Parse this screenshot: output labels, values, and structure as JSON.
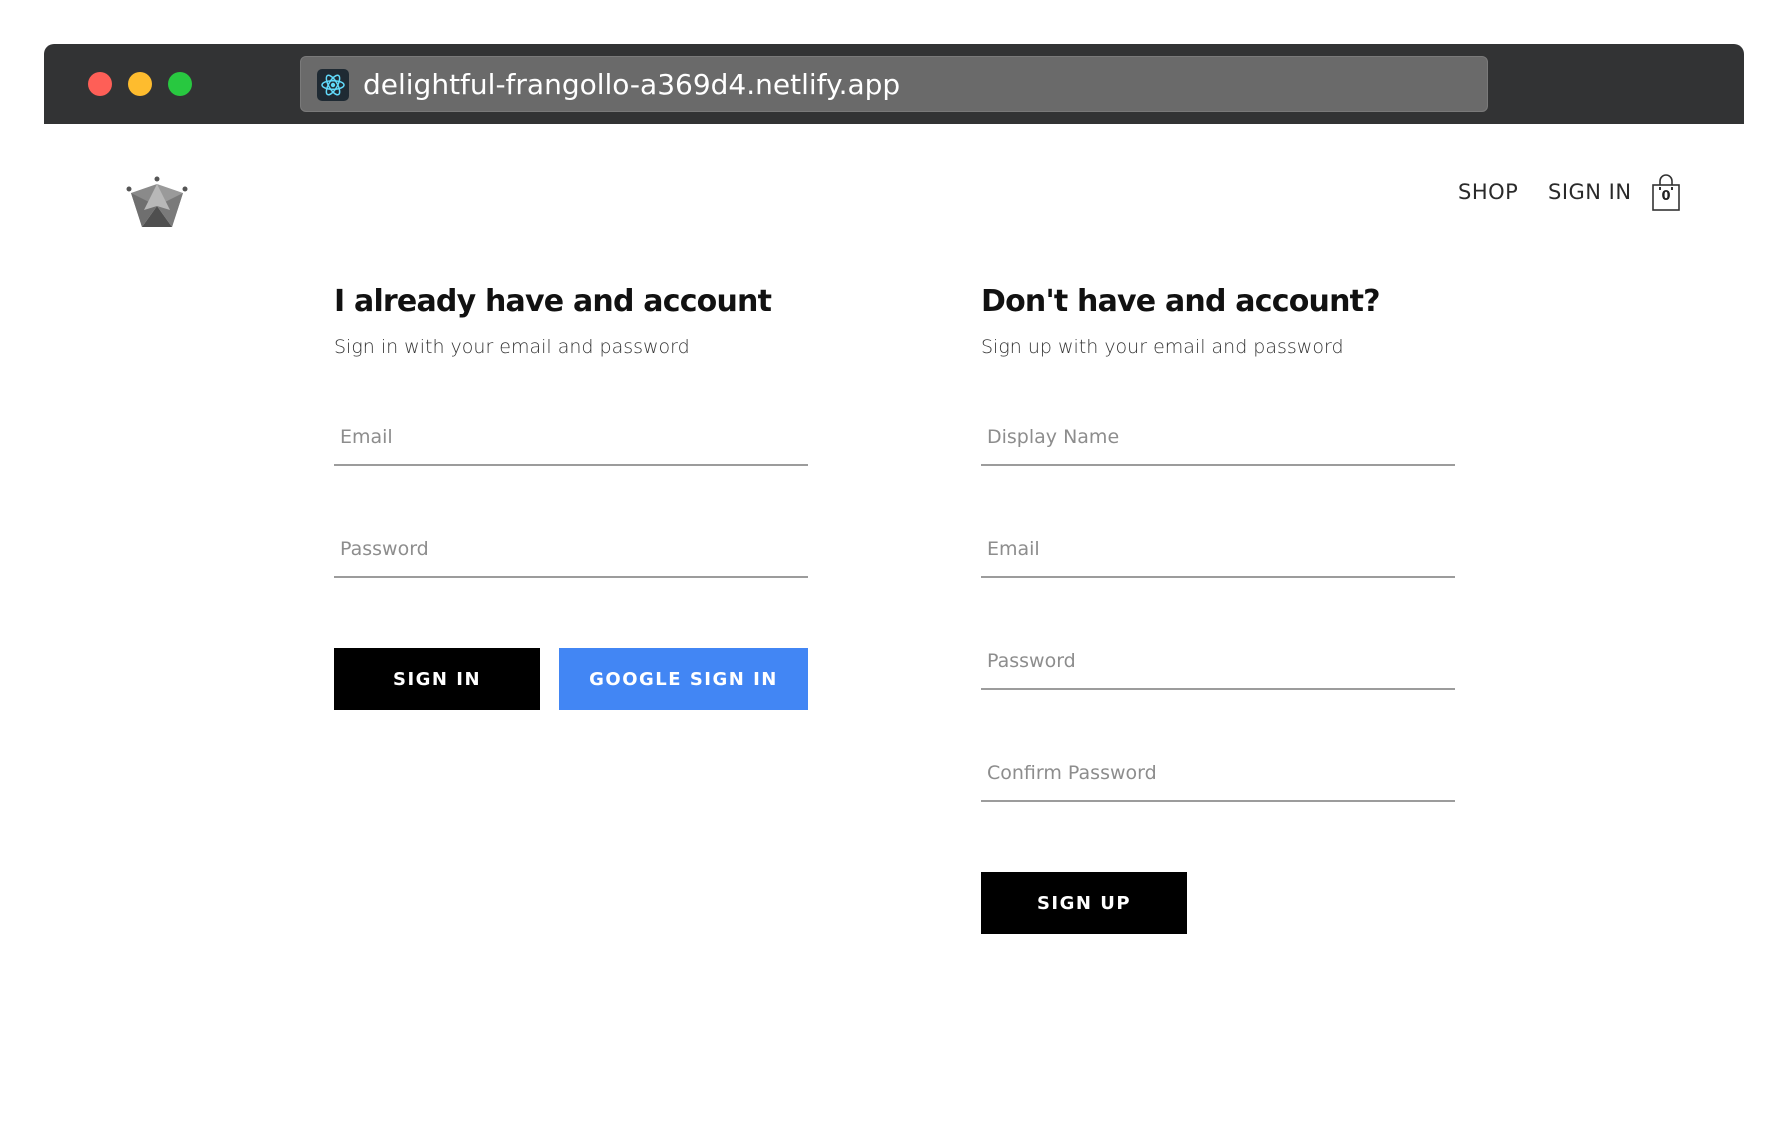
{
  "browser": {
    "url": "delightful-frangollo-a369d4.netlify.app",
    "favicon": "react-atom-icon"
  },
  "header": {
    "logo": "crown-logo-icon",
    "nav": {
      "shop_label": "SHOP",
      "signin_label": "SIGN IN"
    },
    "cart": {
      "icon": "shopping-bag-icon",
      "count": "0"
    }
  },
  "sign_in": {
    "title": "I already have and account",
    "subtitle": "Sign in with your email and password",
    "fields": {
      "email_placeholder": "Email",
      "password_placeholder": "Password"
    },
    "buttons": {
      "signin_label": "SIGN IN",
      "google_label": "GOOGLE SIGN IN"
    }
  },
  "sign_up": {
    "title": "Don't have and account?",
    "subtitle": "Sign up with your email and password",
    "fields": {
      "display_name_placeholder": "Display Name",
      "email_placeholder": "Email",
      "password_placeholder": "Password",
      "confirm_password_placeholder": "Confirm Password"
    },
    "buttons": {
      "signup_label": "SIGN UP"
    }
  },
  "colors": {
    "titlebar": "#323334",
    "google_blue": "#4286f4",
    "button_black": "#000000"
  }
}
